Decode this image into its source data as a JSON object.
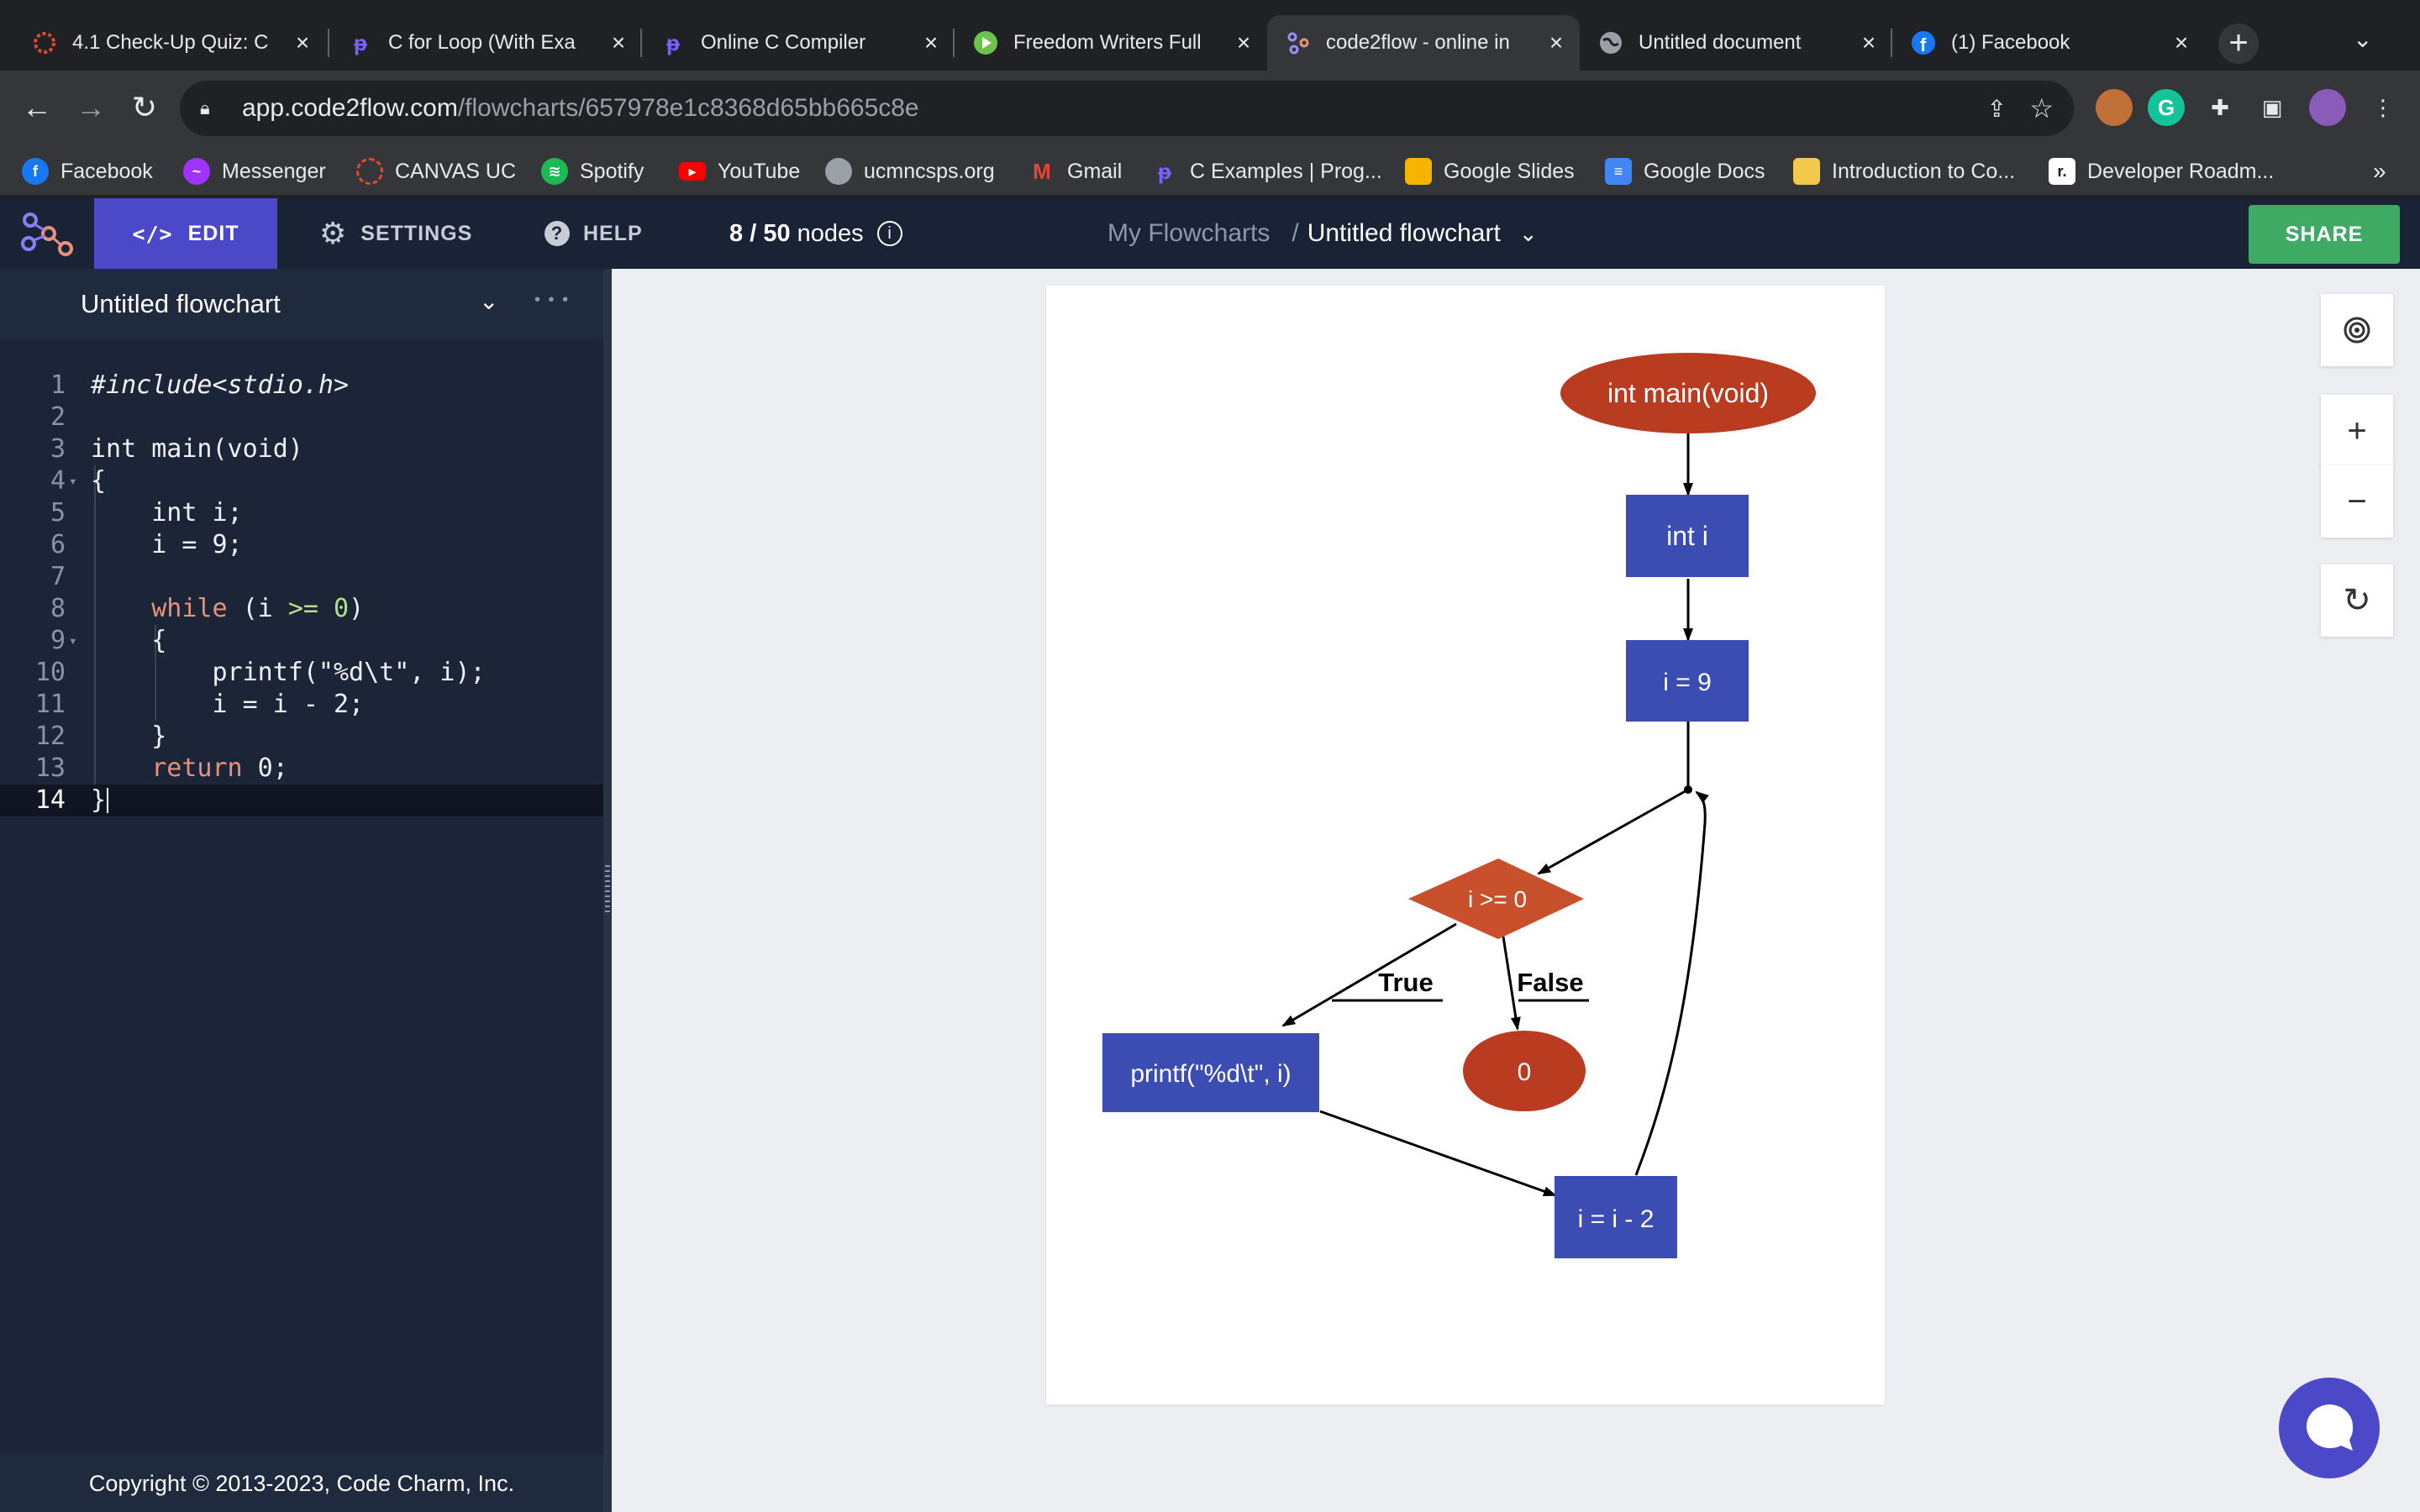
{
  "browser": {
    "tabs": [
      {
        "title": "4.1 Check-Up Quiz: C",
        "icon": "canvas-icon",
        "color": "#e24a2c"
      },
      {
        "title": "C for Loop (With Exa",
        "icon": "programiz-icon",
        "color": "#7b61ff"
      },
      {
        "title": "Online C Compiler",
        "icon": "programiz-icon",
        "color": "#7b61ff"
      },
      {
        "title": "Freedom Writers Full",
        "icon": "play-icon",
        "color": "#6cc24a"
      },
      {
        "title": "code2flow - online in",
        "icon": "code2flow-icon",
        "color": "#9b8cff",
        "active": true
      },
      {
        "title": "Untitled document",
        "icon": "globe-icon",
        "color": "#9aa0a6"
      },
      {
        "title": "(1) Facebook",
        "icon": "facebook-icon",
        "color": "#1877f2"
      }
    ],
    "url_host": "app.code2flow.com",
    "url_path": "/flowcharts/657978e1c8368d65bb665c8e",
    "bookmarks": [
      {
        "label": "Facebook",
        "icon": "facebook-icon",
        "color": "#1877f2"
      },
      {
        "label": "Messenger",
        "icon": "messenger-icon",
        "color": "#a033ff"
      },
      {
        "label": "CANVAS UC",
        "icon": "canvas-icon",
        "color": "#e24a2c"
      },
      {
        "label": "Spotify",
        "icon": "spotify-icon",
        "color": "#1db954"
      },
      {
        "label": "YouTube",
        "icon": "youtube-icon",
        "color": "#ff0000"
      },
      {
        "label": "ucmncsps.org",
        "icon": "site-icon",
        "color": "#9aa0a6"
      },
      {
        "label": "Gmail",
        "icon": "gmail-icon",
        "color": "#ea4335"
      },
      {
        "label": "C Examples | Prog...",
        "icon": "programiz-icon",
        "color": "#7b61ff"
      },
      {
        "label": "Google Slides",
        "icon": "slides-icon",
        "color": "#f4b400"
      },
      {
        "label": "Google Docs",
        "icon": "docs-icon",
        "color": "#4285f4"
      },
      {
        "label": "Introduction to Co...",
        "icon": "course-icon",
        "color": "#f2c94c"
      },
      {
        "label": "Developer Roadm...",
        "icon": "roadmap-icon",
        "color": "#111111"
      }
    ],
    "more_bookmarks": "»"
  },
  "app": {
    "menu": {
      "edit": "EDIT",
      "settings": "SETTINGS",
      "help": "HELP"
    },
    "nodes_used": "8",
    "nodes_max": "50",
    "nodes_suffix": "nodes",
    "breadcrumb_root": "My Flowcharts",
    "breadcrumb_sep": "/",
    "flowchart_title": "Untitled flowchart",
    "share": "SHARE",
    "accent": "#4b49c8",
    "share_color": "#3faa64"
  },
  "editor": {
    "title": "Untitled flowchart",
    "more": "• • •",
    "lines": [
      {
        "n": "1",
        "text": "#include<stdio.h>"
      },
      {
        "n": "2",
        "text": ""
      },
      {
        "n": "3",
        "text": "int main(void)"
      },
      {
        "n": "4",
        "text": "{"
      },
      {
        "n": "5",
        "text": "    int i;"
      },
      {
        "n": "6",
        "text": "    i = 9;"
      },
      {
        "n": "7",
        "text": ""
      },
      {
        "n": "8",
        "text": "    while (i >= 0)"
      },
      {
        "n": "9",
        "text": "    {"
      },
      {
        "n": "10",
        "text": "        printf(\"%d\\t\", i);"
      },
      {
        "n": "11",
        "text": "        i = i - 2;"
      },
      {
        "n": "12",
        "text": "    }"
      },
      {
        "n": "13",
        "text": "    return 0;"
      },
      {
        "n": "14",
        "text": "}"
      }
    ],
    "copyright": "Copyright © 2013-2023, Code Charm, Inc."
  },
  "flowchart": {
    "start": "int main(void)",
    "decl": "int i",
    "assign": "i = 9",
    "condition": "i >= 0",
    "true_label": "True",
    "false_label": "False",
    "body": "printf(\"%d\\t\", i)",
    "end": "0",
    "update": "i = i - 2",
    "colors": {
      "terminal": "#b93b20",
      "process": "#3b4db3",
      "decision": "#c8502a"
    }
  }
}
